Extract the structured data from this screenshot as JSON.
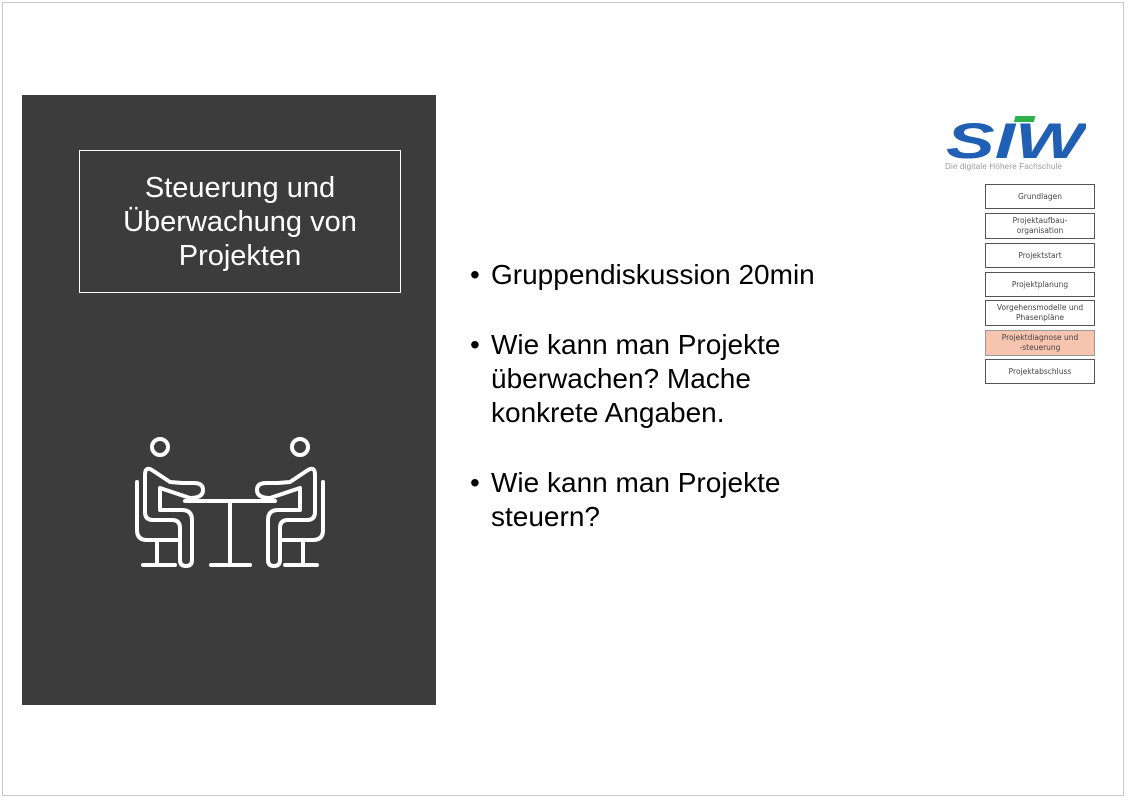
{
  "slide": {
    "title": "Steuerung und Überwachung von Projekten",
    "bullets": [
      "Gruppendiskussion 20min",
      "Wie kann man Projekte überwachen? Mache konkrete Angaben.",
      "Wie kann man Projekte steuern?"
    ],
    "bullet_symbol": "•",
    "icon": "two-people-at-table-icon"
  },
  "logo": {
    "text": "SIW",
    "tagline": "Die digitale Höhere Fachschule",
    "colors": {
      "blue": "#1f5fb4",
      "green": "#2db14a"
    }
  },
  "nav": {
    "items": [
      {
        "label": "Grundlagen"
      },
      {
        "label": "Projektaufbau-organisation"
      },
      {
        "label": "Projektstart"
      },
      {
        "label": "Projektplanung"
      },
      {
        "label": "Vorgehensmodelle und Phasenpläne"
      },
      {
        "label": "Projektdiagnose und -steuerung",
        "active": true
      },
      {
        "label": "Projektabschluss"
      }
    ],
    "active_color": "#f7c4b0"
  }
}
